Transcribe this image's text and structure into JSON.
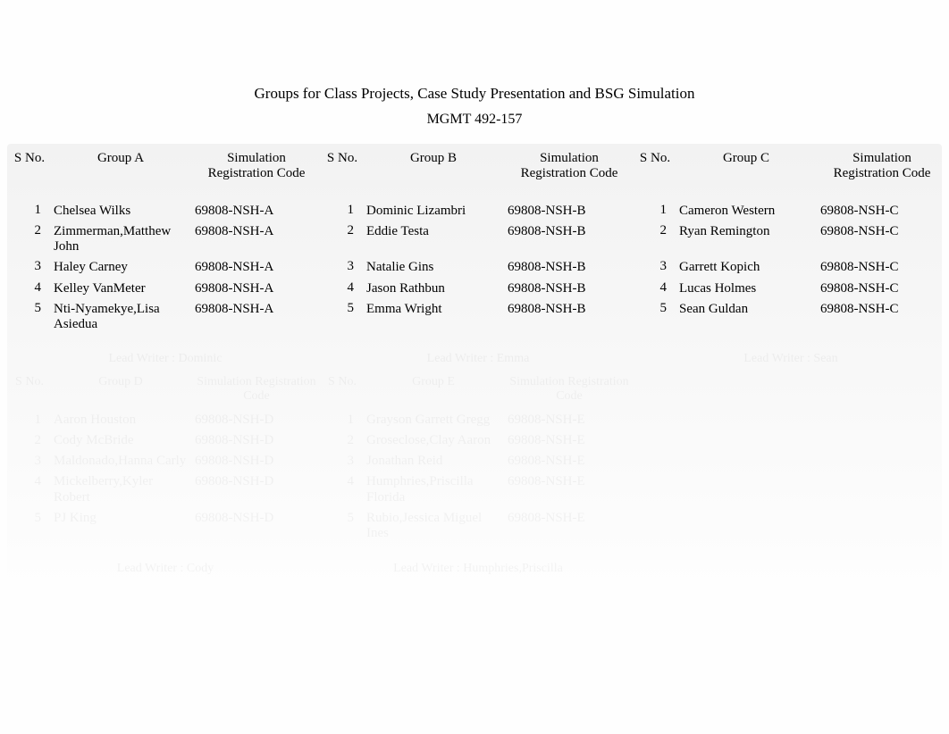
{
  "title": "Groups for Class Projects, Case Study Presentation and BSG Simulation",
  "subtitle": "MGMT 492-157",
  "headers": {
    "sno": "S No.",
    "groupA": "Group A",
    "groupB": "Group B",
    "groupC": "Group C",
    "code": "Simulation Registration Code"
  },
  "groups": [
    {
      "label": "Group A",
      "code": "69808-NSH-A",
      "members": [
        {
          "n": "1",
          "name": "Chelsea Wilks"
        },
        {
          "n": "2",
          "name": "Zimmerman,Matthew John"
        },
        {
          "n": "3",
          "name": "Haley Carney"
        },
        {
          "n": "4",
          "name": "Kelley VanMeter"
        },
        {
          "n": "5",
          "name": "Nti-Nyamekye,Lisa Asiedua"
        }
      ]
    },
    {
      "label": "Group B",
      "code": "69808-NSH-B",
      "members": [
        {
          "n": "1",
          "name": "Dominic Lizambri"
        },
        {
          "n": "2",
          "name": "Eddie Testa"
        },
        {
          "n": "3",
          "name": "Natalie Gins"
        },
        {
          "n": "4",
          "name": "Jason Rathbun"
        },
        {
          "n": "5",
          "name": "Emma Wright"
        }
      ]
    },
    {
      "label": "Group C",
      "code": "69808-NSH-C",
      "members": [
        {
          "n": "1",
          "name": "Cameron Western"
        },
        {
          "n": "2",
          "name": "Ryan Remington"
        },
        {
          "n": "3",
          "name": "Garrett Kopich"
        },
        {
          "n": "4",
          "name": "Lucas Holmes"
        },
        {
          "n": "5",
          "name": "Sean Guldan"
        }
      ]
    }
  ],
  "ghost": {
    "leader_labels": [
      "Lead Writer : Dominic",
      "Lead Writer : Emma",
      "Lead Writer : Sean"
    ],
    "headers": {
      "groupD": "Group D",
      "groupE": "Group E"
    },
    "groups": [
      {
        "code": "69808-NSH-D",
        "members": [
          {
            "n": "1",
            "name": "Aaron Houston"
          },
          {
            "n": "2",
            "name": "Cody McBride"
          },
          {
            "n": "3",
            "name": "Maldonado,Hanna Carly"
          },
          {
            "n": "4",
            "name": "Mickelberry,Kyler Robert"
          },
          {
            "n": "5",
            "name": "PJ King"
          }
        ]
      },
      {
        "code": "69808-NSH-E",
        "members": [
          {
            "n": "1",
            "name": "Grayson Garrett Gregg"
          },
          {
            "n": "2",
            "name": "Groseclose,Clay Aaron"
          },
          {
            "n": "3",
            "name": "Jonathan Reid"
          },
          {
            "n": "4",
            "name": "Humphries,Priscilla Florida"
          },
          {
            "n": "5",
            "name": "Rubio,Jessica Miguel Ines"
          }
        ]
      }
    ],
    "leader_labels2": [
      "Lead Writer : Cody",
      "Lead Writer : Humphries,Priscilla"
    ]
  }
}
